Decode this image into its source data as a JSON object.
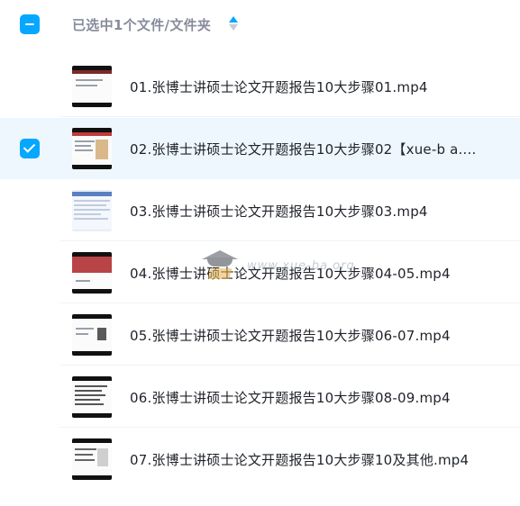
{
  "header": {
    "selection_text": "已选中1个文件/文件夹"
  },
  "files": [
    {
      "name": "01.张博士讲硕士论文开题报告10大步骤01.mp4",
      "selected": false
    },
    {
      "name": "02.张博士讲硕士论文开题报告10大步骤02【xue-b a....",
      "selected": true
    },
    {
      "name": "03.张博士讲硕士论文开题报告10大步骤03.mp4",
      "selected": false
    },
    {
      "name": "04.张博士讲硕士论文开题报告10大步骤04-05.mp4",
      "selected": false
    },
    {
      "name": "05.张博士讲硕士论文开题报告10大步骤06-07.mp4",
      "selected": false
    },
    {
      "name": "06.张博士讲硕士论文开题报告10大步骤08-09.mp4",
      "selected": false
    },
    {
      "name": "07.张博士讲硕士论文开题报告10大步骤10及其他.mp4",
      "selected": false
    }
  ],
  "watermark": {
    "text": "www.xue-ba.org"
  },
  "colors": {
    "accent": "#06a7ff",
    "selected_row": "#eef7fe",
    "header_text": "#878c9c",
    "file_text": "#1f2329"
  }
}
